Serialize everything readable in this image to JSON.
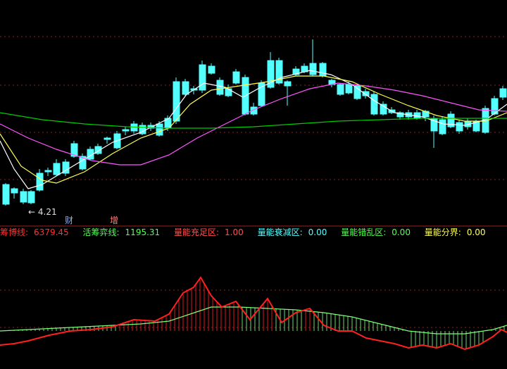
{
  "colors": {
    "up": "#ff3232",
    "down": "#54ffff",
    "ma_short": "#ffffff",
    "ma_mid": "#ffff54",
    "ma_long": "#ff54ff",
    "ma_base": "#00cc00",
    "grid": "#8a1f1f",
    "line_main": "#ff2020",
    "line_sub": "#7cff7c"
  },
  "price_chart": {
    "low_label": "4.21",
    "markers": [
      {
        "label": "财",
        "color": "#7fb0ff"
      },
      {
        "label": "增",
        "color": "#ff8080"
      }
    ]
  },
  "indicator_bar": [
    {
      "label": "筹博线:",
      "value": "6379.45",
      "color": "#ff3232"
    },
    {
      "label": "活筹弈线:",
      "value": "1195.31",
      "color": "#54ff54"
    },
    {
      "label": "量能充足区:",
      "value": "1.00",
      "color": "#ff5050"
    },
    {
      "label": "量能衰减区:",
      "value": "0.00",
      "color": "#54ffff"
    },
    {
      "label": "量能错乱区:",
      "value": "0.00",
      "color": "#54ff54"
    },
    {
      "label": "量能分界:",
      "value": "0.00",
      "color": "#ffff54"
    }
  ]
}
